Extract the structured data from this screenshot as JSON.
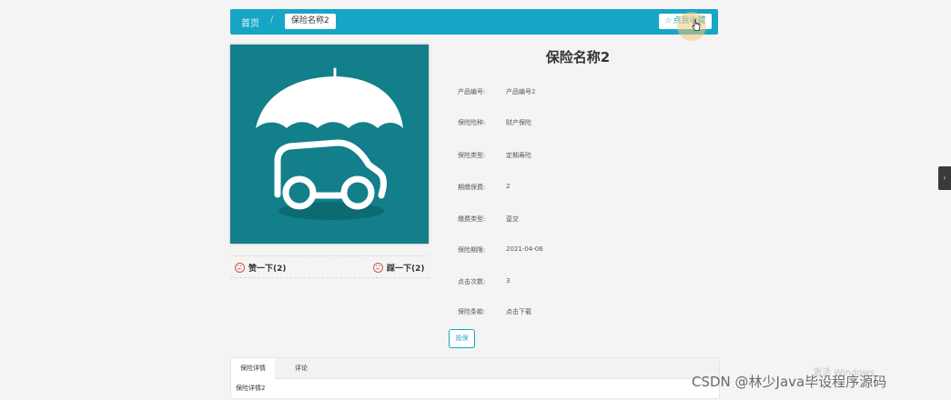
{
  "breadcrumb": {
    "home": "首页",
    "separator": "/",
    "current": "保险名称2"
  },
  "favorite": {
    "label": "点我收藏",
    "icon": "star-icon"
  },
  "product": {
    "title": "保险名称2",
    "image_icon": "umbrella-car-icon",
    "fields": [
      {
        "label": "产品编号:",
        "value": "产品编号2"
      },
      {
        "label": "保险险种:",
        "value": "财产保险"
      },
      {
        "label": "保险类型:",
        "value": "定期寿险"
      },
      {
        "label": "期缴保费:",
        "value": "2"
      },
      {
        "label": "缴费类型:",
        "value": "趸交"
      },
      {
        "label": "保险期限:",
        "value": "2021-04-06"
      },
      {
        "label": "点击次数:",
        "value": "3"
      },
      {
        "label": "保险条款:",
        "value": "点击下载"
      }
    ]
  },
  "votes": {
    "up_label": "赞一下(2)",
    "down_label": "踩一下(2)",
    "icon": "smiley-icon"
  },
  "apply_button": "投保",
  "tabs": [
    {
      "label": "保险详情",
      "active": true
    },
    {
      "label": "评论",
      "active": false
    }
  ],
  "tab_content": "保险详情2",
  "watermarks": {
    "windows": "激活 Windows",
    "csdn": "CSDN @林少Java毕设程序源码"
  },
  "colors": {
    "accent": "#17a5c6",
    "image_bg": "#127f8a",
    "vote_icon": "#d9534f"
  }
}
